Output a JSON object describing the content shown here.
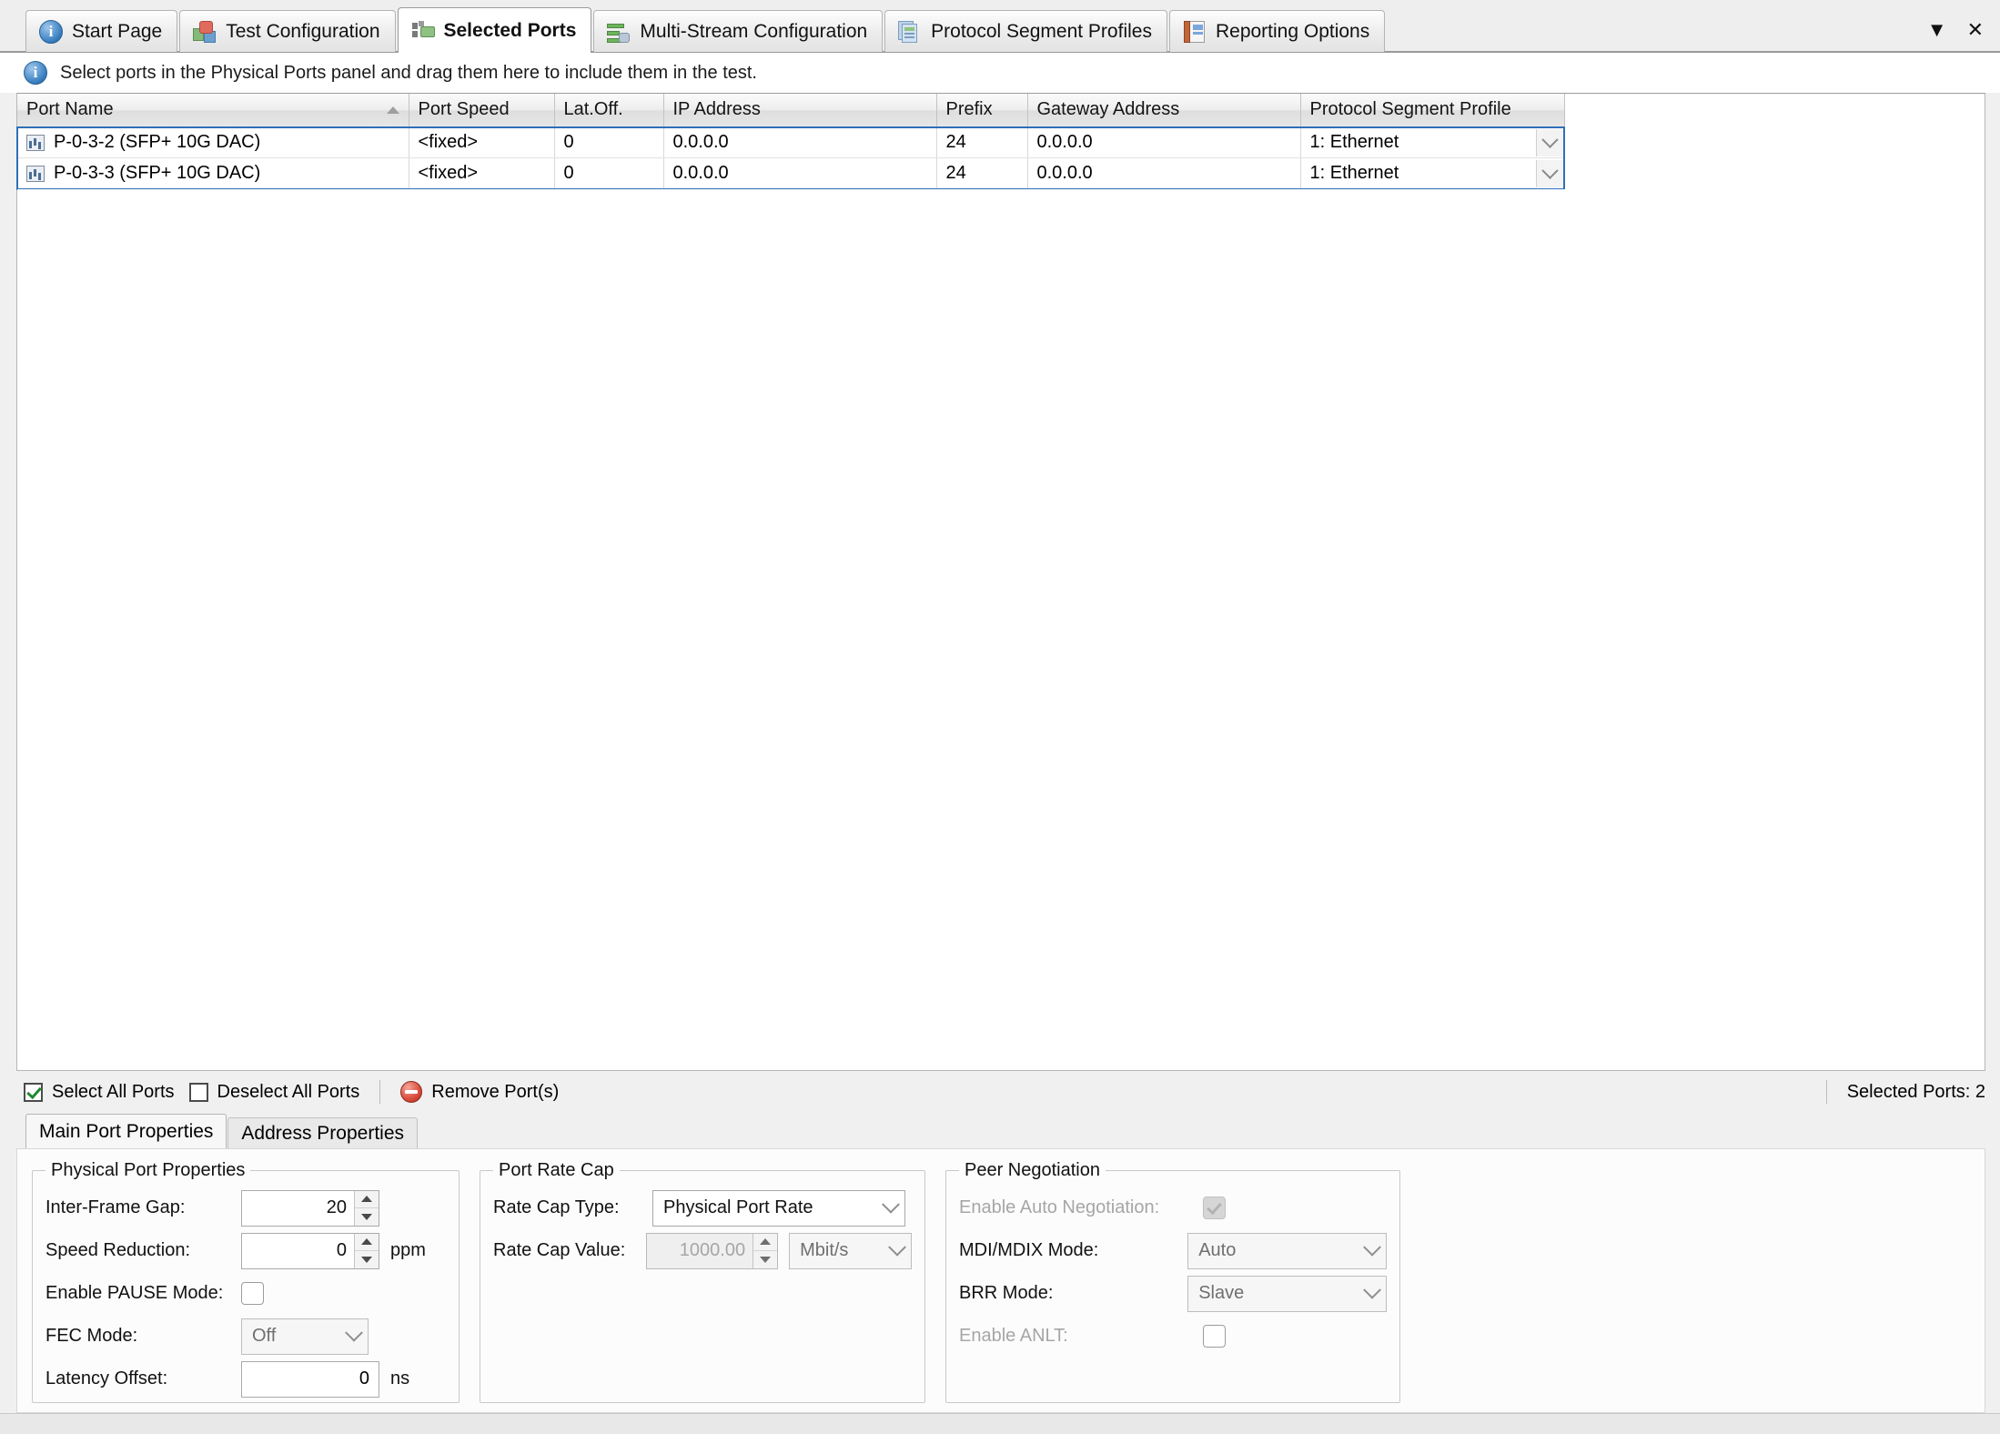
{
  "tabs": [
    {
      "label": "Start Page",
      "icon": "info-circle-icon",
      "active": false
    },
    {
      "label": "Test Configuration",
      "icon": "cubes-icon",
      "active": false
    },
    {
      "label": "Selected Ports",
      "icon": "ports-icon",
      "active": true
    },
    {
      "label": "Multi-Stream Configuration",
      "icon": "stream-icon",
      "active": false
    },
    {
      "label": "Protocol Segment Profiles",
      "icon": "documents-icon",
      "active": false
    },
    {
      "label": "Reporting Options",
      "icon": "report-icon",
      "active": false
    }
  ],
  "window_controls": {
    "dropdown": "▼",
    "close": "✕"
  },
  "infobar": {
    "icon": "info-circle-icon",
    "message": "Select ports in the Physical Ports panel and drag them here to include them in the test."
  },
  "grid": {
    "columns": [
      "Port Name",
      "Port Speed",
      "Lat.Off.",
      "IP Address",
      "Prefix",
      "Gateway Address",
      "Protocol Segment Profile"
    ],
    "sorted_column": "Port Name",
    "sort_direction": "ascending",
    "rows": [
      {
        "port_name": "P-0-3-2 (SFP+ 10G DAC)",
        "port_speed": "<fixed>",
        "lat_off": "0",
        "ip_address": "0.0.0.0",
        "prefix": "24",
        "gateway_address": "0.0.0.0",
        "protocol_segment_profile": "1: Ethernet"
      },
      {
        "port_name": "P-0-3-3 (SFP+ 10G DAC)",
        "port_speed": "<fixed>",
        "lat_off": "0",
        "ip_address": "0.0.0.0",
        "prefix": "24",
        "gateway_address": "0.0.0.0",
        "protocol_segment_profile": "1: Ethernet"
      }
    ]
  },
  "actionbar": {
    "select_all": "Select All Ports",
    "select_all_checked": true,
    "deselect_all": "Deselect All Ports",
    "deselect_all_checked": false,
    "remove_ports": "Remove Port(s)",
    "remove_icon": "remove-circle-icon",
    "status": "Selected Ports: 2"
  },
  "subtabs": [
    {
      "label": "Main Port Properties",
      "active": true
    },
    {
      "label": "Address Properties",
      "active": false
    }
  ],
  "physical_port_properties": {
    "legend": "Physical Port Properties",
    "inter_frame_gap": {
      "label": "Inter-Frame Gap:",
      "value": "20"
    },
    "speed_reduction": {
      "label": "Speed Reduction:",
      "value": "0",
      "unit": "ppm"
    },
    "enable_pause_mode": {
      "label": "Enable PAUSE Mode:",
      "checked": false
    },
    "fec_mode": {
      "label": "FEC Mode:",
      "value": "Off",
      "enabled": false
    },
    "latency_offset": {
      "label": "Latency Offset:",
      "value": "0",
      "unit": "ns"
    }
  },
  "port_rate_cap": {
    "legend": "Port Rate Cap",
    "rate_cap_type": {
      "label": "Rate Cap Type:",
      "value": "Physical Port Rate",
      "enabled": true
    },
    "rate_cap_value": {
      "label": "Rate Cap Value:",
      "value": "1000.00",
      "unit": "Mbit/s",
      "enabled": false
    }
  },
  "peer_negotiation": {
    "legend": "Peer Negotiation",
    "enable_auto_negotiation": {
      "label": "Enable Auto Negotiation:",
      "checked": true,
      "enabled": false
    },
    "mdi_mdix_mode": {
      "label": "MDI/MDIX Mode:",
      "value": "Auto",
      "enabled": false
    },
    "brr_mode": {
      "label": "BRR Mode:",
      "value": "Slave",
      "enabled": false
    },
    "enable_anlt": {
      "label": "Enable ANLT:",
      "checked": false,
      "enabled": false
    }
  },
  "colors": {
    "selection_blue": "#2f6fb8",
    "window_bg": "#f0f0f0",
    "grid_bg": "#ffffff"
  }
}
